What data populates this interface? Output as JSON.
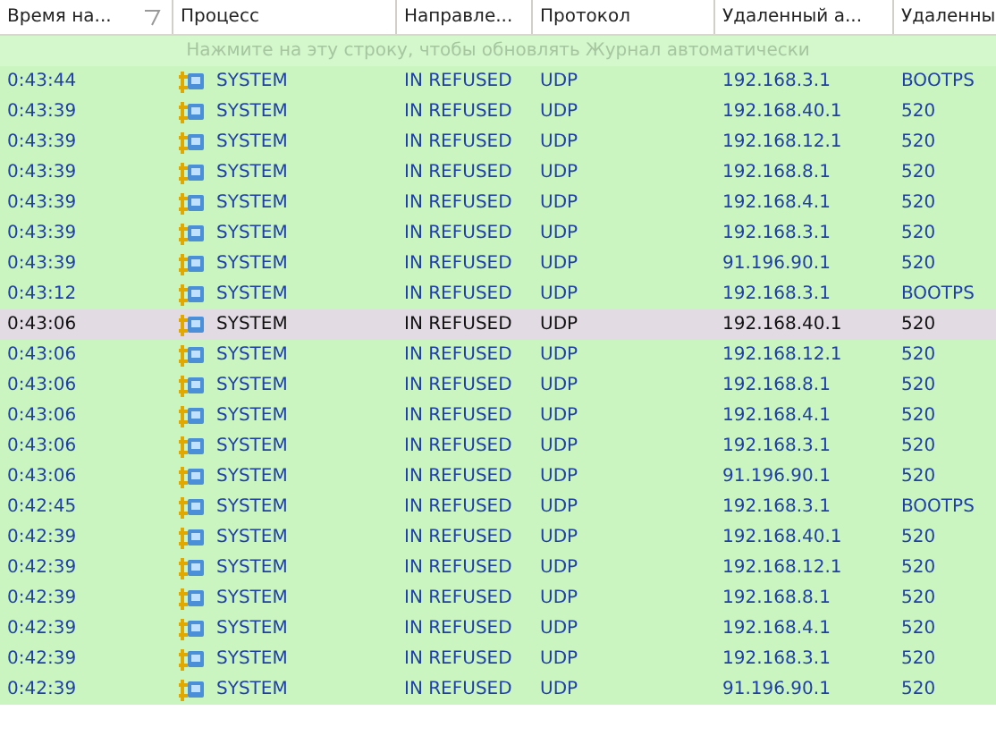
{
  "columns": [
    "Время на...",
    "Процесс",
    "Направле...",
    "Протокол",
    "Удаленный а...",
    "Удаленны"
  ],
  "notice": "Нажмите на эту строку, чтобы обновлять Журнал автоматически",
  "rows": [
    {
      "time": "0:43:44",
      "process": "SYSTEM",
      "direction": "IN REFUSED",
      "protocol": "UDP",
      "address": "192.168.3.1",
      "port": "BOOTPS",
      "selected": false
    },
    {
      "time": "0:43:39",
      "process": "SYSTEM",
      "direction": "IN REFUSED",
      "protocol": "UDP",
      "address": "192.168.40.1",
      "port": "520",
      "selected": false
    },
    {
      "time": "0:43:39",
      "process": "SYSTEM",
      "direction": "IN REFUSED",
      "protocol": "UDP",
      "address": "192.168.12.1",
      "port": "520",
      "selected": false
    },
    {
      "time": "0:43:39",
      "process": "SYSTEM",
      "direction": "IN REFUSED",
      "protocol": "UDP",
      "address": "192.168.8.1",
      "port": "520",
      "selected": false
    },
    {
      "time": "0:43:39",
      "process": "SYSTEM",
      "direction": "IN REFUSED",
      "protocol": "UDP",
      "address": "192.168.4.1",
      "port": "520",
      "selected": false
    },
    {
      "time": "0:43:39",
      "process": "SYSTEM",
      "direction": "IN REFUSED",
      "protocol": "UDP",
      "address": "192.168.3.1",
      "port": "520",
      "selected": false
    },
    {
      "time": "0:43:39",
      "process": "SYSTEM",
      "direction": "IN REFUSED",
      "protocol": "UDP",
      "address": "91.196.90.1",
      "port": "520",
      "selected": false
    },
    {
      "time": "0:43:12",
      "process": "SYSTEM",
      "direction": "IN REFUSED",
      "protocol": "UDP",
      "address": "192.168.3.1",
      "port": "BOOTPS",
      "selected": false
    },
    {
      "time": "0:43:06",
      "process": "SYSTEM",
      "direction": "IN REFUSED",
      "protocol": "UDP",
      "address": "192.168.40.1",
      "port": "520",
      "selected": true
    },
    {
      "time": "0:43:06",
      "process": "SYSTEM",
      "direction": "IN REFUSED",
      "protocol": "UDP",
      "address": "192.168.12.1",
      "port": "520",
      "selected": false
    },
    {
      "time": "0:43:06",
      "process": "SYSTEM",
      "direction": "IN REFUSED",
      "protocol": "UDP",
      "address": "192.168.8.1",
      "port": "520",
      "selected": false
    },
    {
      "time": "0:43:06",
      "process": "SYSTEM",
      "direction": "IN REFUSED",
      "protocol": "UDP",
      "address": "192.168.4.1",
      "port": "520",
      "selected": false
    },
    {
      "time": "0:43:06",
      "process": "SYSTEM",
      "direction": "IN REFUSED",
      "protocol": "UDP",
      "address": "192.168.3.1",
      "port": "520",
      "selected": false
    },
    {
      "time": "0:43:06",
      "process": "SYSTEM",
      "direction": "IN REFUSED",
      "protocol": "UDP",
      "address": "91.196.90.1",
      "port": "520",
      "selected": false
    },
    {
      "time": "0:42:45",
      "process": "SYSTEM",
      "direction": "IN REFUSED",
      "protocol": "UDP",
      "address": "192.168.3.1",
      "port": "BOOTPS",
      "selected": false
    },
    {
      "time": "0:42:39",
      "process": "SYSTEM",
      "direction": "IN REFUSED",
      "protocol": "UDP",
      "address": "192.168.40.1",
      "port": "520",
      "selected": false
    },
    {
      "time": "0:42:39",
      "process": "SYSTEM",
      "direction": "IN REFUSED",
      "protocol": "UDP",
      "address": "192.168.12.1",
      "port": "520",
      "selected": false
    },
    {
      "time": "0:42:39",
      "process": "SYSTEM",
      "direction": "IN REFUSED",
      "protocol": "UDP",
      "address": "192.168.8.1",
      "port": "520",
      "selected": false
    },
    {
      "time": "0:42:39",
      "process": "SYSTEM",
      "direction": "IN REFUSED",
      "protocol": "UDP",
      "address": "192.168.4.1",
      "port": "520",
      "selected": false
    },
    {
      "time": "0:42:39",
      "process": "SYSTEM",
      "direction": "IN REFUSED",
      "protocol": "UDP",
      "address": "192.168.3.1",
      "port": "520",
      "selected": false
    },
    {
      "time": "0:42:39",
      "process": "SYSTEM",
      "direction": "IN REFUSED",
      "protocol": "UDP",
      "address": "91.196.90.1",
      "port": "520",
      "selected": false
    }
  ]
}
